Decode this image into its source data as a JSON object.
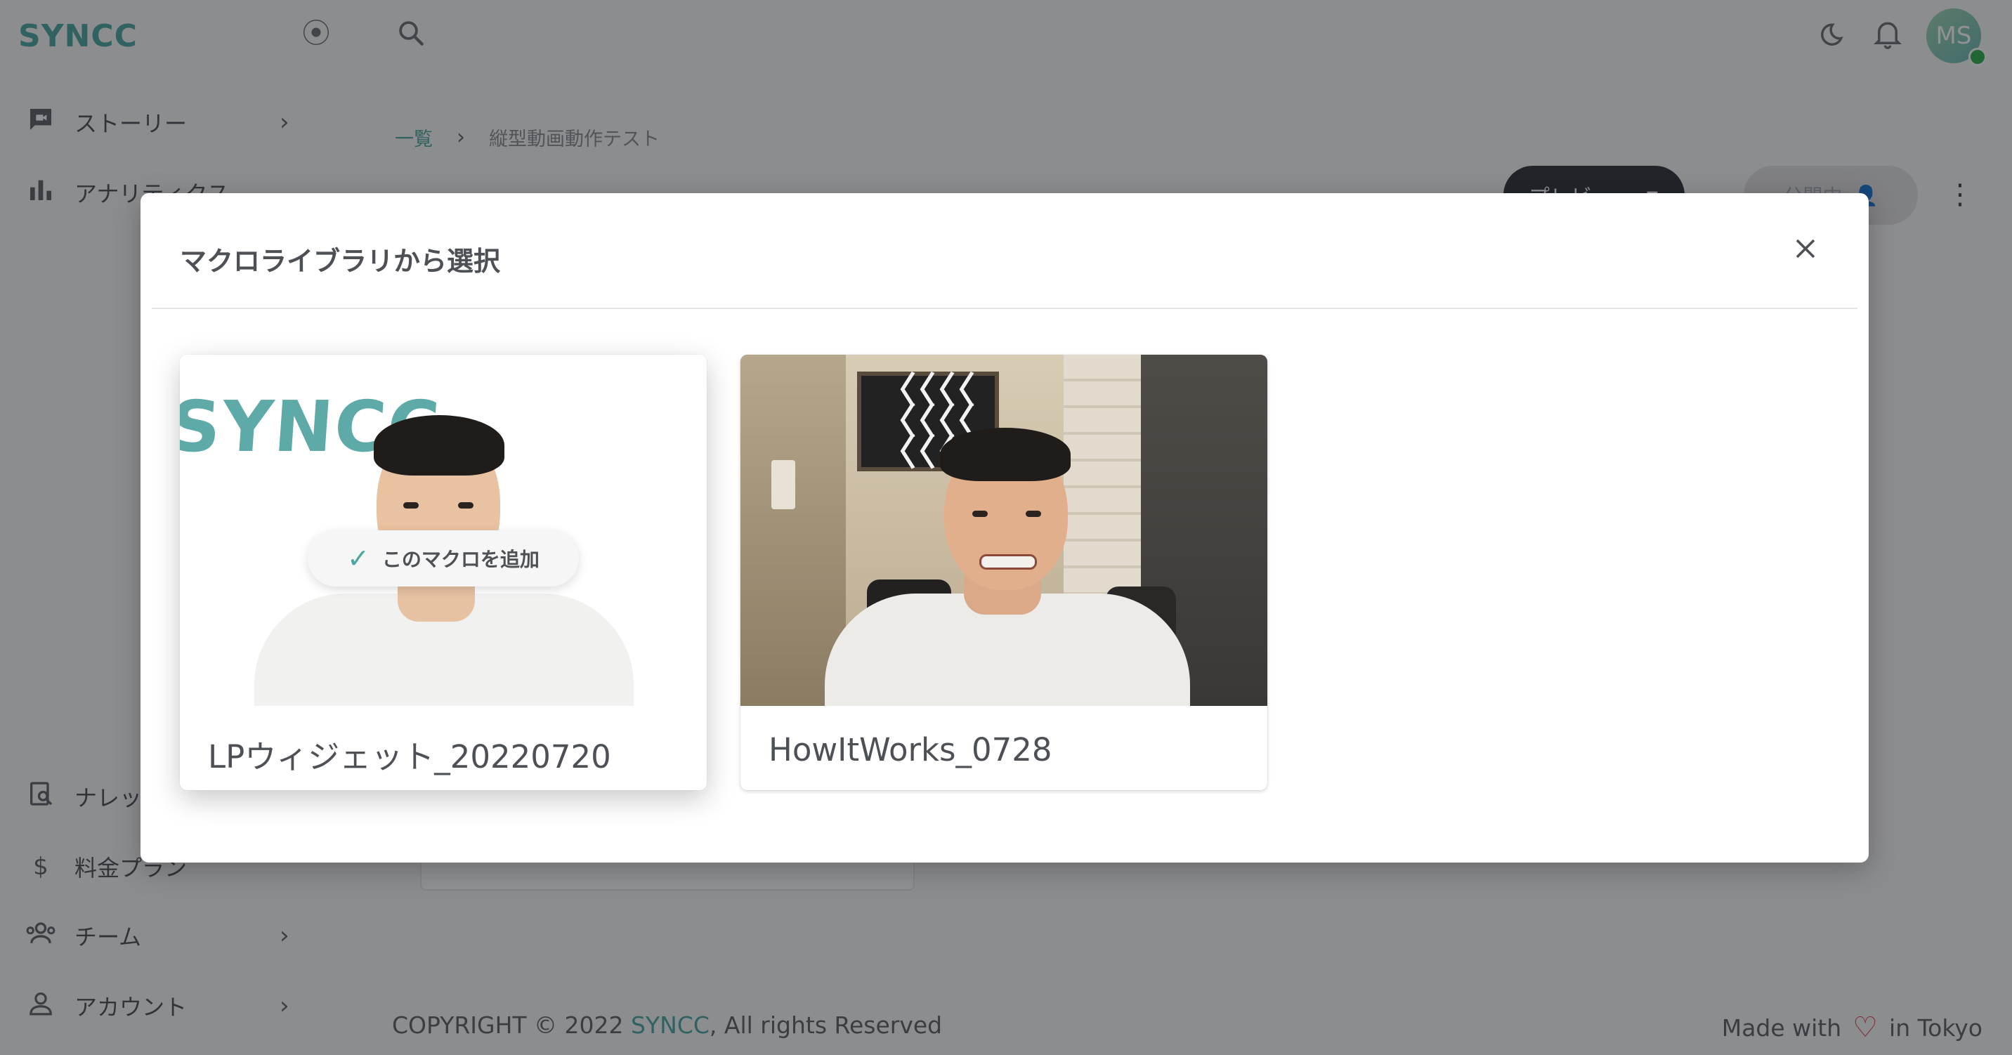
{
  "app": {
    "logo": "SYNCC",
    "avatar_initials": "MS"
  },
  "topbar": {
    "icons": [
      "target-icon",
      "search-icon",
      "moon-icon",
      "bell-icon"
    ]
  },
  "sidebar": {
    "top_items": [
      {
        "label": "ストーリー",
        "icon": "video-chat-icon",
        "has_chevron": true
      },
      {
        "label": "アナリティクス",
        "icon": "bar-chart-icon",
        "has_chevron": false
      }
    ],
    "bottom_items": [
      {
        "label": "ナレッジ",
        "icon": "knowledge-icon",
        "has_chevron": false
      },
      {
        "label": "料金プラン",
        "icon": "dollar-icon",
        "has_chevron": false
      },
      {
        "label": "チーム",
        "icon": "team-icon",
        "has_chevron": true
      },
      {
        "label": "アカウント",
        "icon": "account-icon",
        "has_chevron": true
      }
    ]
  },
  "breadcrumb": {
    "root": "一覧",
    "current": "縦型動画動作テスト"
  },
  "toolbar": {
    "preview_label": "プレビュー",
    "publish_label": "公開中"
  },
  "footer": {
    "copyright_prefix": "COPYRIGHT © 2022",
    "brand": "SYNCC",
    "copyright_suffix": ", All rights Reserved",
    "made_with": "Made with",
    "in_tokyo": "in Tokyo"
  },
  "modal": {
    "title": "マクロライブラリから選択",
    "add_label": "このマクロを追加",
    "cards": [
      {
        "label": "LPウィジェット_20220720",
        "thumb_watermark": "SYNCC",
        "selected": true
      },
      {
        "label": "HowItWorks_0728",
        "selected": false
      }
    ]
  },
  "colors": {
    "brand": "#4aa7a3",
    "overlay": "rgba(20,22,26,0.47)",
    "heart": "#d93f44"
  }
}
